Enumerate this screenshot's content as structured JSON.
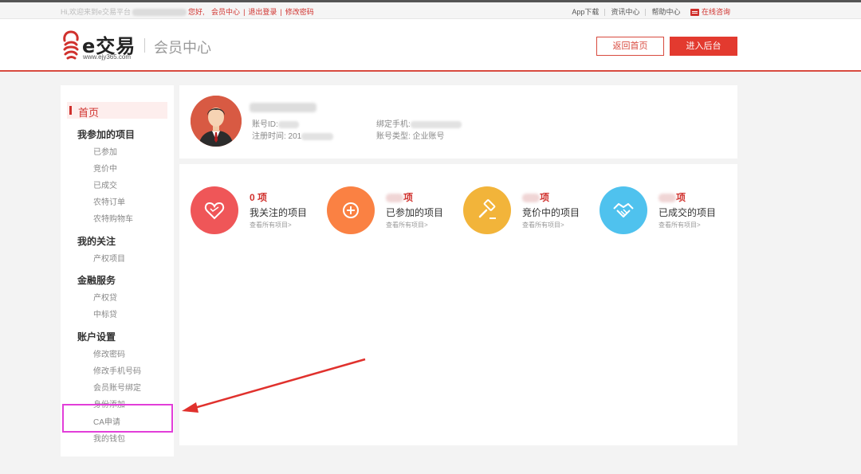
{
  "topbar": {
    "greeting_prefix": "Hi,欢迎来到e交易平台",
    "greeting_suffix": "您好,",
    "member_center": "会员中心",
    "logout": "退出登录",
    "change_password": "修改密码",
    "app_download": "App下载",
    "news_center": "资讯中心",
    "help_center": "帮助中心",
    "online_consult": "在线咨询"
  },
  "header": {
    "logo_text": "e交易",
    "logo_url": "www.ejy365.com",
    "title": "会员中心",
    "back_home_label": "返回首页",
    "enter_admin_label": "进入后台"
  },
  "sidebar": {
    "home": "首页",
    "groups": [
      {
        "title": "我参加的项目",
        "items": [
          "已参加",
          "竞价中",
          "已成交",
          "农特订单",
          "农特购物车"
        ]
      },
      {
        "title": "我的关注",
        "items": [
          "产权项目"
        ]
      },
      {
        "title": "金融服务",
        "items": [
          "产权贷",
          "中标贷"
        ]
      },
      {
        "title": "账户设置",
        "items": [
          "修改密码",
          "修改手机号码",
          "会员账号绑定",
          "身份添加",
          "CA申请",
          "我的钱包"
        ]
      }
    ]
  },
  "profile": {
    "account_id_label": "账号ID:",
    "register_time_label": "注册时间: 201",
    "bind_phone_label": "绑定手机:",
    "account_type_label": "账号类型: 企业账号"
  },
  "stats": [
    {
      "count": "0 项",
      "title": "我关注的项目",
      "link": "查看所有项目>",
      "color": "#ef5658",
      "icon": "heart-icon"
    },
    {
      "count": "项",
      "title": "已参加的项目",
      "link": "查看所有项目>",
      "color": "#fa8143",
      "icon": "plus-icon"
    },
    {
      "count": "项",
      "title": "竞价中的项目",
      "link": "查看所有项目>",
      "color": "#f2b43a",
      "icon": "gavel-icon"
    },
    {
      "count": "项",
      "title": "已成交的项目",
      "link": "查看所有项目>",
      "color": "#4fc2ee",
      "icon": "handshake-icon"
    }
  ],
  "colors": {
    "brand_red": "#d0312d",
    "highlight_magenta": "#e23ed9",
    "arrow_red": "#e0312d"
  }
}
